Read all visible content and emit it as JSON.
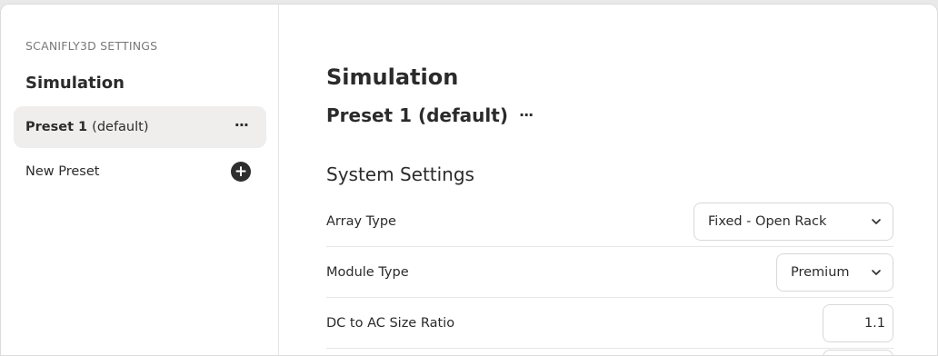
{
  "sidebar": {
    "heading": "SCANIFLY3D SETTINGS",
    "section_title": "Simulation",
    "presets": [
      {
        "name": "Preset 1",
        "suffix": "(default)",
        "more_label": "···",
        "selected": true
      }
    ],
    "new_preset_label": "New Preset",
    "new_preset_icon": "plus-circle-icon"
  },
  "main": {
    "title": "Simulation",
    "preset_title": "Preset 1 (default)",
    "preset_more_label": "···",
    "section_title": "System Settings",
    "settings": [
      {
        "label": "Array Type",
        "kind": "select",
        "value": "Fixed - Open Rack"
      },
      {
        "label": "Module Type",
        "kind": "select",
        "value": "Premium"
      },
      {
        "label": "DC to AC Size Ratio",
        "kind": "number",
        "value": "1.1"
      }
    ]
  },
  "colors": {
    "selected_bg": "#efeeec",
    "text": "#2b2b2b",
    "muted": "#7a7a7a",
    "border": "#d8d8d8"
  }
}
